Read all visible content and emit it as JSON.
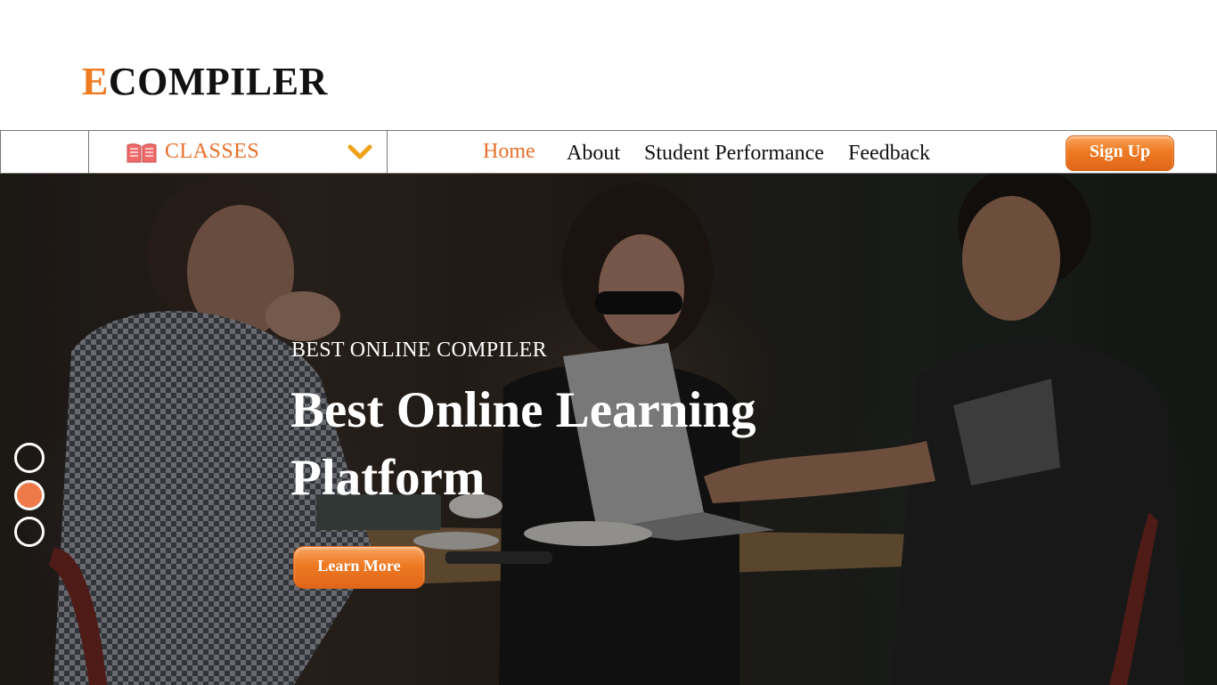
{
  "logo": {
    "accent_letter": "E",
    "rest": "COMPILER"
  },
  "nav": {
    "classes_label": "CLASSES",
    "links": [
      {
        "label": "Home",
        "active": true
      },
      {
        "label": "About",
        "active": false
      },
      {
        "label": "Student Performance",
        "active": false
      },
      {
        "label": "Feedback",
        "active": false
      }
    ],
    "signup_label": "Sign Up"
  },
  "hero": {
    "subtitle": "BEST ONLINE COMPILER",
    "title": "Best Online Learning Platform",
    "button_label": "Learn More",
    "slides": {
      "count": 3,
      "active_index": 1
    }
  },
  "colors": {
    "accent": "#ee7a22",
    "dark_text": "#111111"
  },
  "icons": {
    "classes": "open-book-icon",
    "dropdown": "chevron-down-icon"
  }
}
